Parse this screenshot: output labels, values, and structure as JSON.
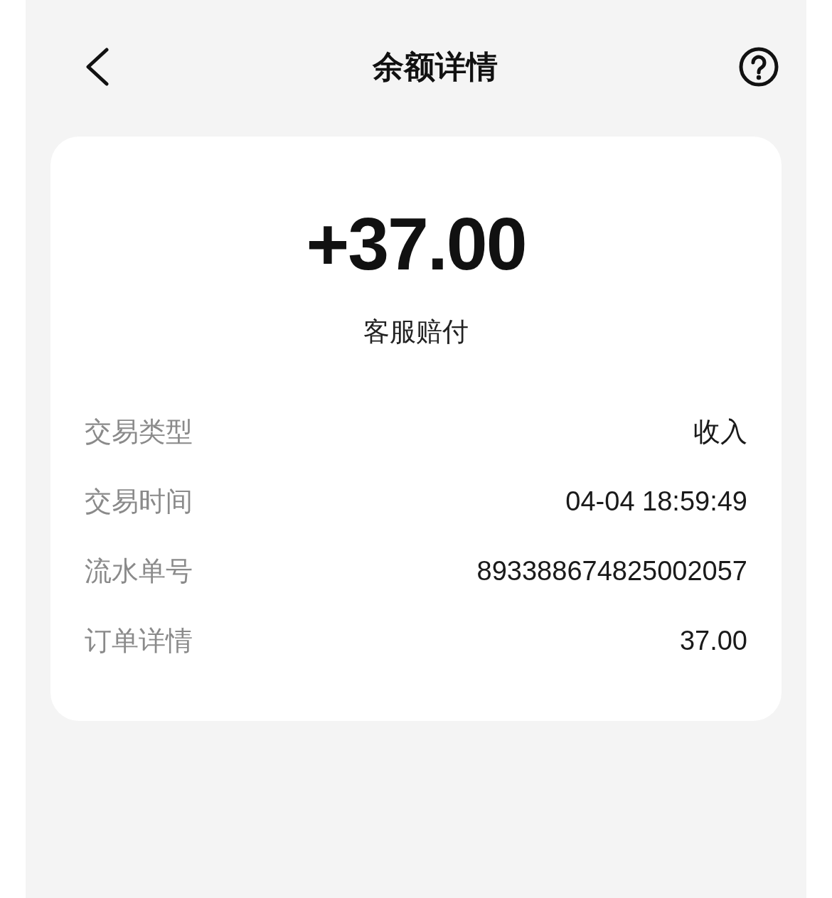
{
  "header": {
    "title": "余额详情"
  },
  "amount": "+37.00",
  "description": "客服赔付",
  "details": [
    {
      "label": "交易类型",
      "value": "收入"
    },
    {
      "label": "交易时间",
      "value": "04-04 18:59:49"
    },
    {
      "label": "流水单号",
      "value": "893388674825002057"
    },
    {
      "label": "订单详情",
      "value": "37.00"
    }
  ]
}
